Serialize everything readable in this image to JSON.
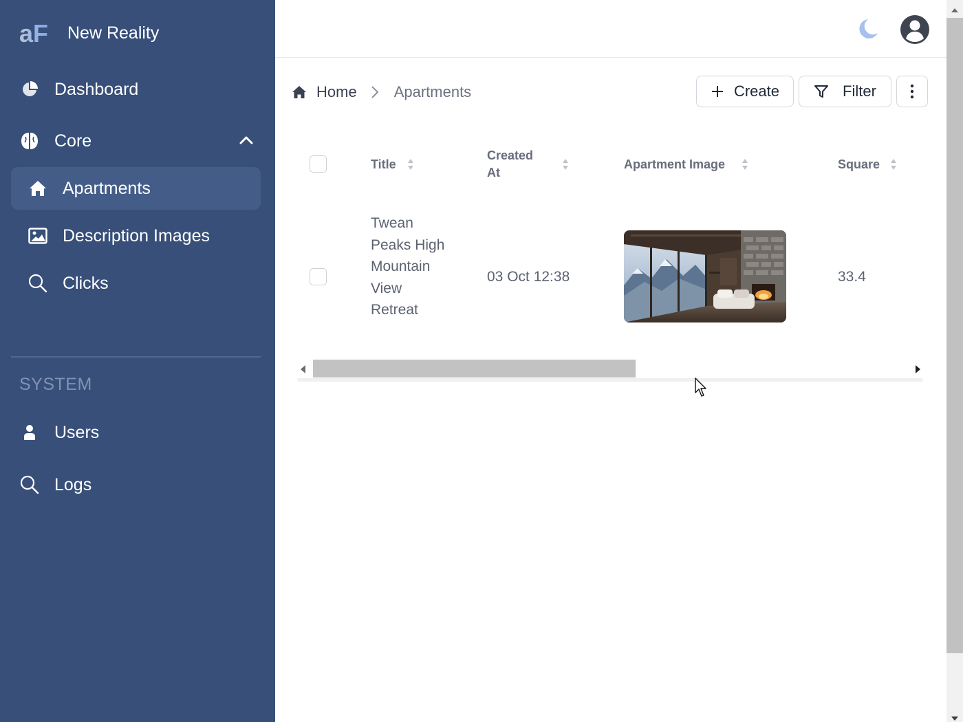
{
  "app": {
    "name": "New Reality",
    "logo_text": "aF"
  },
  "sidebar": {
    "items": [
      {
        "label": "Dashboard",
        "icon": "pie-chart-icon"
      },
      {
        "label": "Core",
        "icon": "brain-icon",
        "expanded": true
      },
      {
        "label": "Apartments",
        "icon": "home-icon",
        "active": true
      },
      {
        "label": "Description Images",
        "icon": "image-icon"
      },
      {
        "label": "Clicks",
        "icon": "search-icon"
      }
    ],
    "section_label": "SYSTEM",
    "system_items": [
      {
        "label": "Users",
        "icon": "user-icon"
      },
      {
        "label": "Logs",
        "icon": "search-icon"
      }
    ]
  },
  "topbar": {
    "theme_toggle_icon": "moon-icon",
    "avatar_icon": "user-circle-icon"
  },
  "breadcrumb": {
    "home": "Home",
    "current": "Apartments"
  },
  "actions": {
    "create": "Create",
    "filter": "Filter",
    "more_icon": "dots-vertical-icon"
  },
  "table": {
    "columns": [
      "Title",
      "Created At",
      "Apartment Image",
      "Square"
    ],
    "rows": [
      {
        "title": "Twean Peaks High Mountain View Retreat",
        "created_at": "03 Oct 12:38",
        "image": "mountain-apartment-photo",
        "square": "33.4"
      }
    ]
  },
  "colors": {
    "sidebar_bg": "#374f79",
    "sidebar_active": "#445d88",
    "accent_moon": "#a8c0f0"
  }
}
